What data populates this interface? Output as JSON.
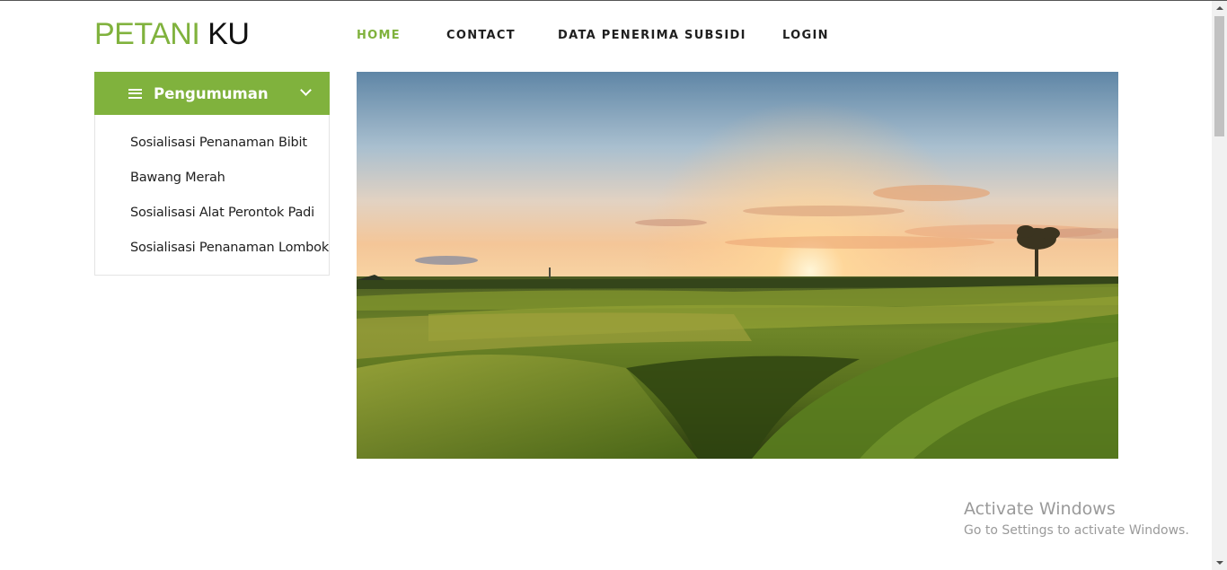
{
  "brand": {
    "part1": "PETANI",
    "part2": "KU"
  },
  "nav": [
    {
      "label": "HOME",
      "active": true
    },
    {
      "label": "CONTACT",
      "active": false
    },
    {
      "label": "DATA PENERIMA SUBSIDI",
      "active": false
    },
    {
      "label": "LOGIN",
      "active": false
    }
  ],
  "sidebar": {
    "title": "Pengumuman",
    "menu_icon": "hamburger-icon",
    "toggle_icon": "chevron-down-icon",
    "items": [
      {
        "label": "Sosialisasi Penanaman Bibit"
      },
      {
        "label": "Bawang Merah"
      },
      {
        "label": "Sosialisasi Alat Perontok Padi"
      },
      {
        "label": "Sosialisasi Penanaman Lombok"
      }
    ]
  },
  "hero": {
    "alt": "rice-field-sunset"
  },
  "windows_watermark": {
    "line1": "Activate Windows",
    "line2": "Go to Settings to activate Windows."
  },
  "colors": {
    "accent": "#80b23d",
    "text": "#1f1f1f"
  }
}
